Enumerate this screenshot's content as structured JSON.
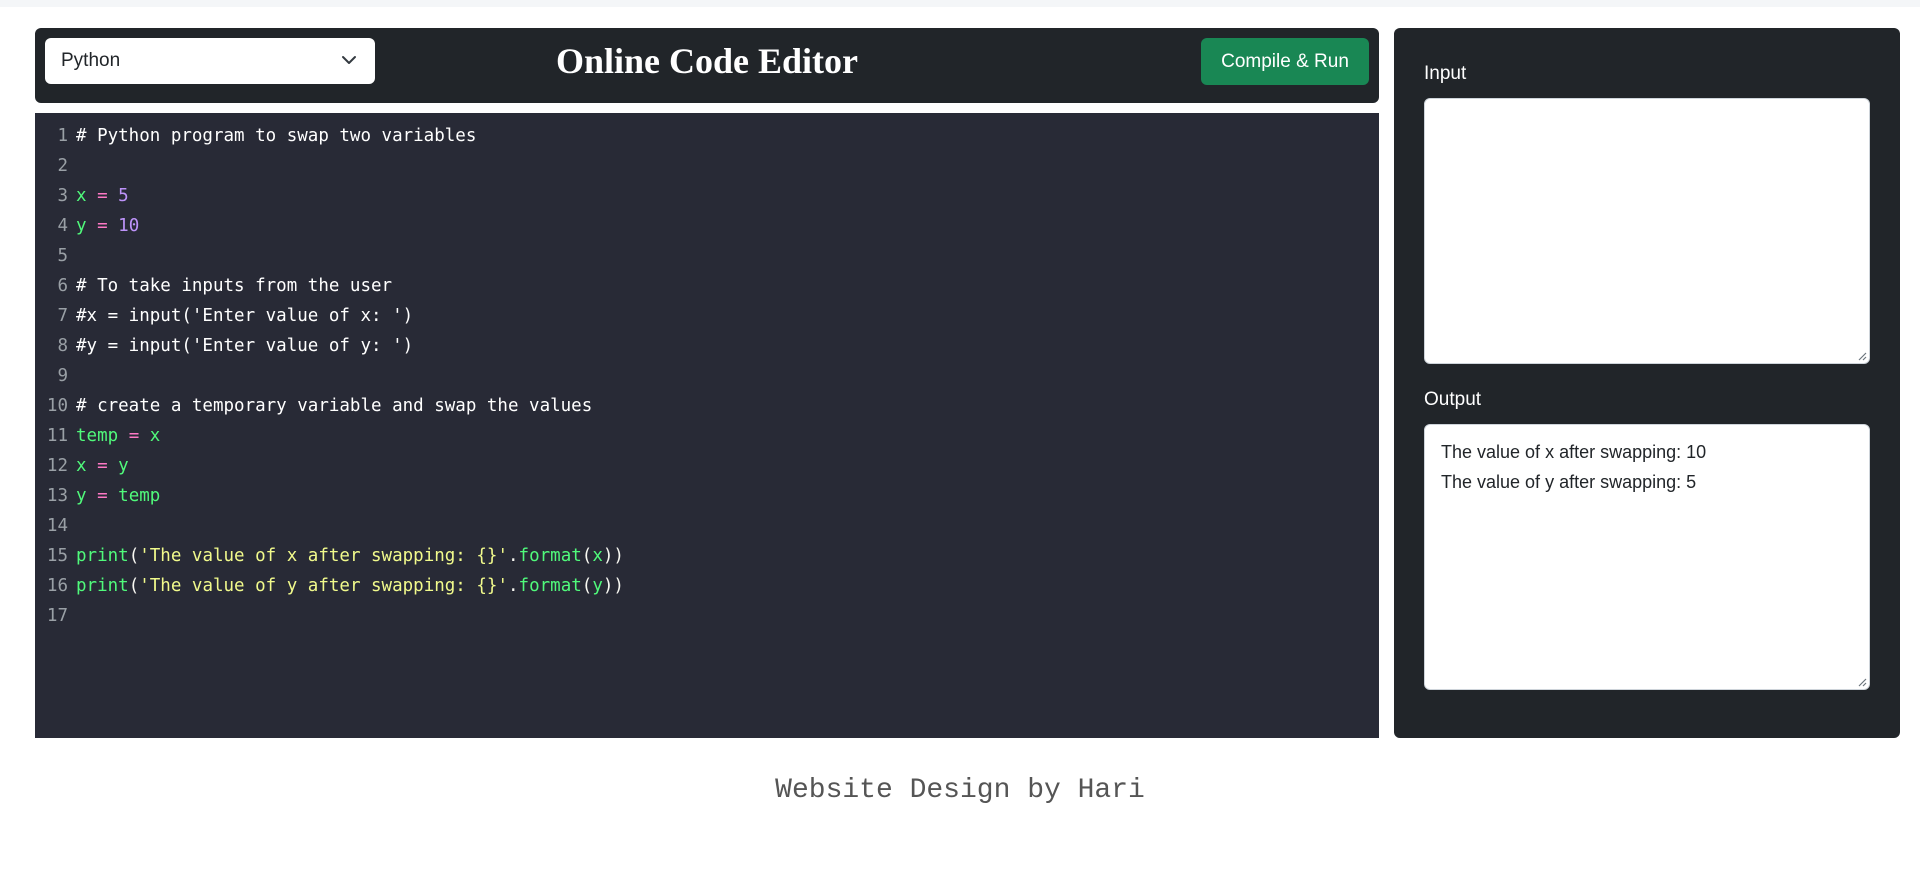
{
  "header": {
    "language_selected": "Python",
    "title": "Online Code Editor",
    "run_button": "Compile & Run"
  },
  "editor": {
    "lines": [
      [
        {
          "t": "# Python program to swap two variables",
          "c": "comment"
        }
      ],
      [],
      [
        {
          "t": "x",
          "c": "var"
        },
        {
          "t": " = ",
          "c": "op"
        },
        {
          "t": "5",
          "c": "num"
        }
      ],
      [
        {
          "t": "y",
          "c": "var"
        },
        {
          "t": " = ",
          "c": "op"
        },
        {
          "t": "10",
          "c": "num"
        }
      ],
      [],
      [
        {
          "t": "# To take inputs from the user",
          "c": "comment"
        }
      ],
      [
        {
          "t": "#x = input('Enter value of x: ')",
          "c": "comment"
        }
      ],
      [
        {
          "t": "#y = input('Enter value of y: ')",
          "c": "comment"
        }
      ],
      [],
      [
        {
          "t": "# create a temporary variable and swap the values",
          "c": "comment"
        }
      ],
      [
        {
          "t": "temp",
          "c": "var"
        },
        {
          "t": " = ",
          "c": "op"
        },
        {
          "t": "x",
          "c": "var"
        }
      ],
      [
        {
          "t": "x",
          "c": "var"
        },
        {
          "t": " = ",
          "c": "op"
        },
        {
          "t": "y",
          "c": "var"
        }
      ],
      [
        {
          "t": "y",
          "c": "var"
        },
        {
          "t": " = ",
          "c": "op"
        },
        {
          "t": "temp",
          "c": "var"
        }
      ],
      [],
      [
        {
          "t": "print",
          "c": "func"
        },
        {
          "t": "(",
          "c": "punc"
        },
        {
          "t": "'The value of x after swapping: {}'",
          "c": "str"
        },
        {
          "t": ".",
          "c": "punc"
        },
        {
          "t": "format",
          "c": "func"
        },
        {
          "t": "(",
          "c": "punc"
        },
        {
          "t": "x",
          "c": "var"
        },
        {
          "t": "))",
          "c": "punc"
        }
      ],
      [
        {
          "t": "print",
          "c": "func"
        },
        {
          "t": "(",
          "c": "punc"
        },
        {
          "t": "'The value of y after swapping: {}'",
          "c": "str"
        },
        {
          "t": ".",
          "c": "punc"
        },
        {
          "t": "format",
          "c": "func"
        },
        {
          "t": "(",
          "c": "punc"
        },
        {
          "t": "y",
          "c": "var"
        },
        {
          "t": "))",
          "c": "punc"
        }
      ],
      []
    ]
  },
  "panel": {
    "input_label": "Input",
    "input_value": "",
    "output_label": "Output",
    "output_lines": [
      "The value of x after swapping: 10",
      "The value of y after swapping: 5"
    ]
  },
  "footer": {
    "credit": "Website Design by Hari"
  },
  "colors": {
    "header_bg": "#212529",
    "editor_bg": "#282a36",
    "run_button_bg": "#198754"
  },
  "icons": {
    "select_arrow": "chevron-down-icon",
    "resize": "resize-grip-icon"
  }
}
